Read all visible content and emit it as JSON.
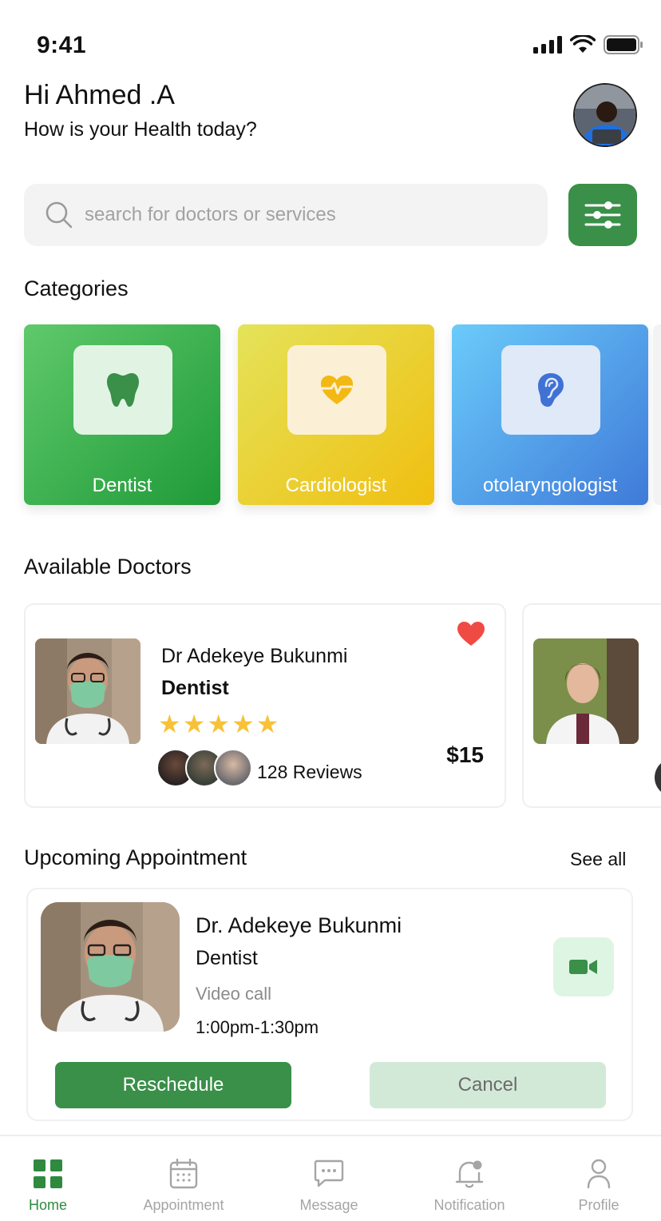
{
  "status_bar": {
    "time": "9:41"
  },
  "greeting": {
    "title": "Hi Ahmed .A",
    "subtitle": "How is your Health today?"
  },
  "search": {
    "placeholder": "search for doctors or services",
    "value": ""
  },
  "categories": {
    "title": "Categories",
    "items": [
      {
        "label": "Dentist",
        "icon": "tooth-icon",
        "color": "#3aa64a"
      },
      {
        "label": "Cardiologist",
        "icon": "heart-pulse-icon",
        "color": "#ecc928"
      },
      {
        "label": "otolaryngologist",
        "icon": "ear-icon",
        "color": "#4c9ee6"
      }
    ]
  },
  "available_doctors": {
    "title": "Available Doctors",
    "doctors": [
      {
        "name": "Dr Adekeye Bukunmi",
        "specialty": "Dentist",
        "rating": 5,
        "stars": "★★★★★",
        "reviews": "128 Reviews",
        "price": "$15",
        "favorite": true
      }
    ]
  },
  "upcoming": {
    "title": "Upcoming Appointment",
    "see_all": "See all",
    "appointment": {
      "name": "Dr. Adekeye Bukunmi",
      "specialty": "Dentist",
      "type": "Video call",
      "time": "1:00pm-1:30pm",
      "reschedule_label": "Reschedule",
      "cancel_label": "Cancel"
    }
  },
  "nav": {
    "items": [
      {
        "label": "Home",
        "active": true
      },
      {
        "label": "Appointment",
        "active": false
      },
      {
        "label": "Message",
        "active": false
      },
      {
        "label": "Notification",
        "active": false
      },
      {
        "label": "Profile",
        "active": false
      }
    ]
  },
  "colors": {
    "primary": "#3a8f49",
    "star": "#f7c238",
    "heart": "#f04a45"
  }
}
